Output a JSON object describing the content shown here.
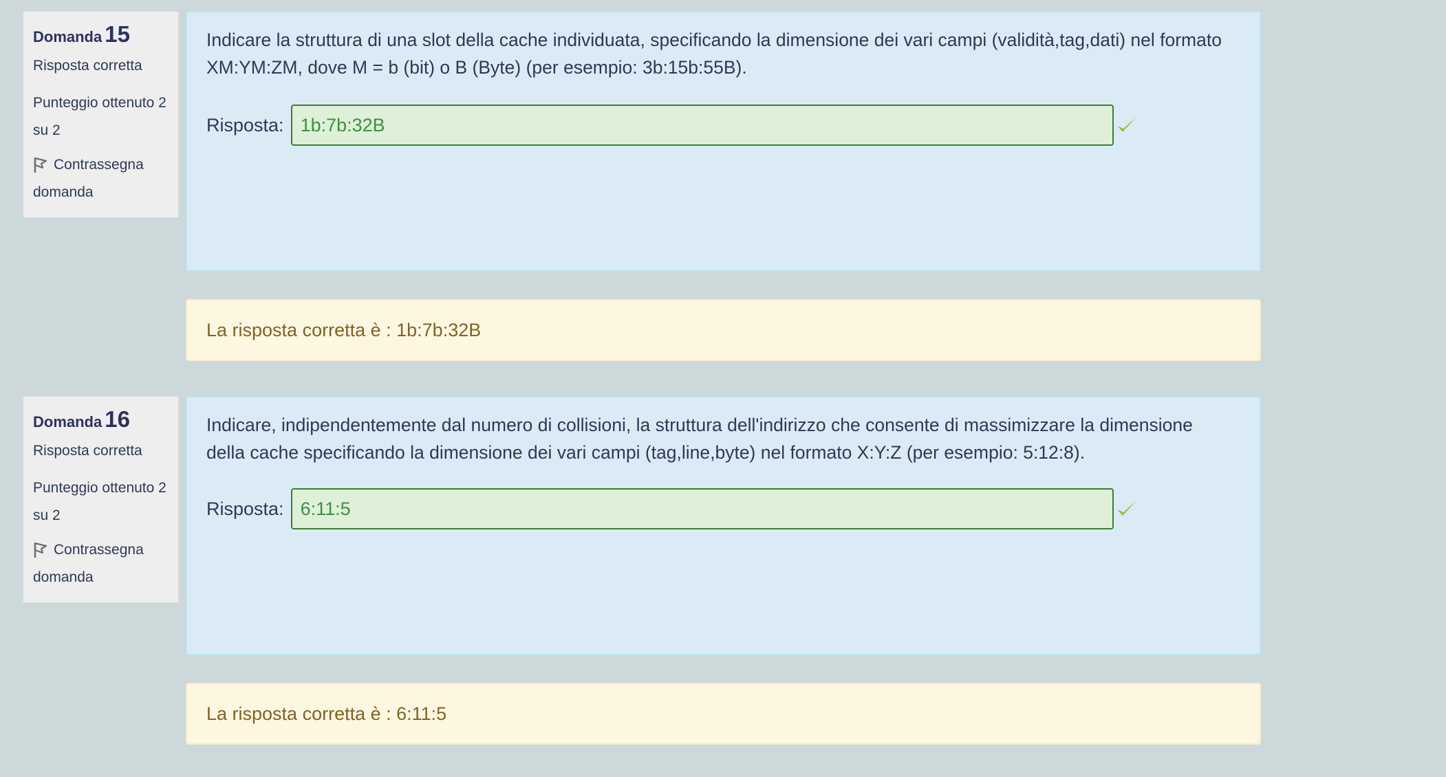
{
  "questions": [
    {
      "label": "Domanda",
      "number": "15",
      "state": "Risposta corretta",
      "grade": "Punteggio ottenuto 2 su 2",
      "flag_label": "Contrassegna domanda",
      "text": "Indicare la struttura di una slot della cache individuata, specificando la dimensione dei vari campi (validità,tag,dati) nel formato XM:YM:ZM, dove M = b (bit) o B (Byte) (per esempio: 3b:15b:55B).",
      "answer_label": "Risposta:",
      "answer_value": "1b:7b:32B",
      "right_answer": "La risposta corretta è : 1b:7b:32B"
    },
    {
      "label": "Domanda",
      "number": "16",
      "state": "Risposta corretta",
      "grade": "Punteggio ottenuto 2 su 2",
      "flag_label": "Contrassegna domanda",
      "text": "Indicare, indipendentemente dal numero di collisioni, la struttura dell'indirizzo che consente di massimizzare la dimensione della cache specificando la dimensione dei vari campi (tag,line,byte) nel formato X:Y:Z (per esempio: 5:12:8).",
      "answer_label": "Risposta:",
      "answer_value": "6:11:5",
      "right_answer": "La risposta corretta è : 6:11:5"
    }
  ],
  "icons": {
    "flag": "flag-icon",
    "correct": "check-icon"
  },
  "colors": {
    "background": "#cdd8da",
    "formulation_bg": "#dbebf6",
    "answer_bg": "#dff0d8",
    "answer_border": "#3d7d31",
    "answer_text": "#3e8f3e",
    "check": "#8dc63f",
    "outcome_bg": "#fdf6e1",
    "outcome_text": "#7d6426"
  }
}
